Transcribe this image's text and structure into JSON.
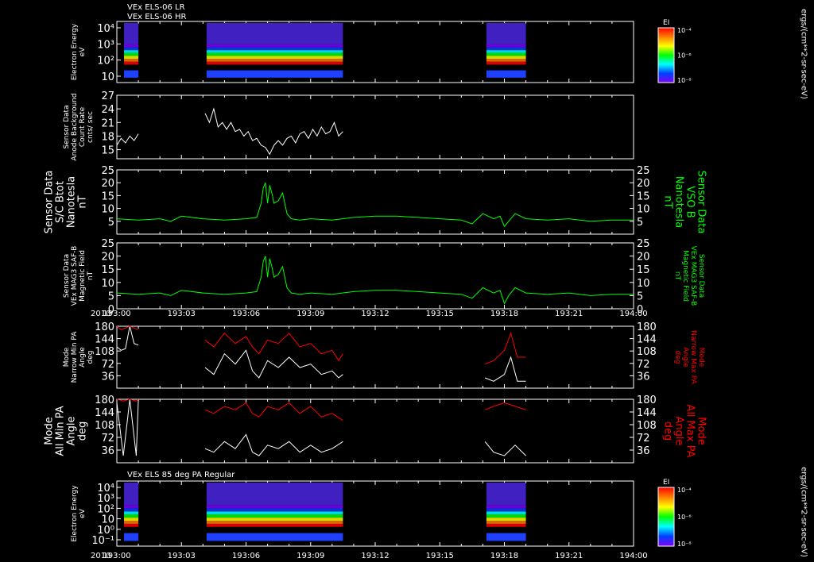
{
  "header": {
    "line1": "VEx ELS-06 LR",
    "line2": "VEx ELS-06 HR",
    "bottom_title": "VEx ELS 85 deg PA Regular"
  },
  "colorbar": {
    "label": "EI",
    "ticks": [
      "10⁻⁴",
      "10⁻⁶",
      "10⁻⁸"
    ],
    "unit": "ergs/(cm**2-sr-sec-eV)",
    "colors": [
      "#ff0000",
      "#ff8000",
      "#ffff00",
      "#00ff00",
      "#00ffff",
      "#0040ff",
      "#8000ff"
    ]
  },
  "x_axis": {
    "year": "2010",
    "ticks": [
      "193:00",
      "193:03",
      "193:06",
      "193:09",
      "193:12",
      "193:15",
      "193:18",
      "193:21",
      "194:00"
    ]
  },
  "colors": {
    "white": "#ffffff",
    "green": "#00ff00",
    "red": "#ff0000"
  },
  "chart_data": [
    {
      "type": "heatmap",
      "name": "panel1",
      "ylabel": [
        "Electron Energy",
        "eV"
      ],
      "yticks": [
        "10⁴",
        "10³",
        "10²",
        "10"
      ],
      "active_intervals": [
        [
          "193:00:20",
          "193:01:00"
        ],
        [
          "193:04:10",
          "193:10:30"
        ],
        [
          "193:17:10",
          "193:19:00"
        ]
      ]
    },
    {
      "type": "line",
      "name": "panel2",
      "ylabel": [
        "Sensor Data",
        "Anode Background",
        "Count Rate",
        "cnts/ sec"
      ],
      "yticks": [
        "27",
        "24",
        "21",
        "18",
        "15"
      ],
      "ylim": [
        13,
        27
      ],
      "series": [
        {
          "color": "white",
          "x": [
            0.0,
            0.2,
            0.4,
            0.6,
            0.8,
            1.0
          ],
          "y": [
            16,
            17.5,
            16.5,
            18,
            17,
            18.5
          ]
        },
        {
          "color": "white",
          "x": [
            4.1,
            4.3,
            4.5,
            4.7,
            4.9,
            5.1,
            5.3,
            5.5,
            5.7,
            5.9,
            6.1,
            6.3,
            6.5,
            6.7,
            6.9,
            7.1,
            7.3,
            7.5,
            7.7,
            7.9,
            8.1,
            8.3,
            8.5,
            8.7,
            8.9,
            9.1,
            9.3,
            9.5,
            9.7,
            9.9,
            10.1,
            10.3,
            10.5
          ],
          "y": [
            23,
            21,
            24,
            20,
            21,
            19.5,
            21,
            19,
            19.5,
            18,
            19,
            17,
            17.5,
            16,
            15.5,
            14,
            16,
            17,
            16,
            17.5,
            18,
            16.5,
            18.5,
            19,
            17.5,
            19.5,
            18,
            20,
            18.5,
            19,
            21,
            18,
            19
          ]
        }
      ]
    },
    {
      "type": "line",
      "name": "panel3",
      "ylabel": [
        "Sensor Data",
        "S/C Btot",
        "Nanotesla",
        "nT"
      ],
      "ylabel_right": [
        "Sensor Data",
        "VSO B",
        "Nanotesla",
        "nT"
      ],
      "yticks": [
        "25",
        "20",
        "15",
        "10",
        "5"
      ],
      "ylim": [
        0,
        25
      ],
      "series": [
        {
          "color": "green",
          "x": [
            0,
            1,
            2,
            2.5,
            3,
            4,
            5,
            6,
            6.5,
            6.7,
            6.8,
            6.9,
            7.0,
            7.1,
            7.2,
            7.3,
            7.5,
            7.7,
            7.9,
            8.1,
            8.5,
            9,
            10,
            11,
            12,
            13,
            14,
            15,
            16,
            16.5,
            17,
            17.5,
            17.8,
            18,
            18.2,
            18.5,
            19,
            20,
            21,
            22,
            23,
            24
          ],
          "y": [
            6,
            5.5,
            6,
            5,
            7,
            6,
            5.5,
            6,
            6.5,
            12,
            18,
            20,
            12,
            19,
            16,
            12,
            13,
            16,
            8,
            6,
            5.5,
            6,
            5.5,
            6.5,
            7,
            7,
            6.5,
            6,
            5.5,
            4,
            8,
            6,
            7,
            3,
            5,
            8,
            6,
            5.5,
            6,
            5,
            5.5,
            5.5
          ]
        }
      ]
    },
    {
      "type": "line",
      "name": "panel4",
      "ylabel": [
        "Sensor Data",
        "VEx MAG3 SAF-B",
        "Magnetic Field",
        "nT"
      ],
      "ylabel_right": [
        "Sensor Data",
        "VEx MAG3 SAF-B",
        "Magnetic Field",
        "nT"
      ],
      "yticks": [
        "25",
        "20",
        "15",
        "10",
        "5",
        "0"
      ],
      "ylim": [
        0,
        25
      ],
      "series": [
        {
          "color": "green",
          "x": [
            0,
            1,
            2,
            2.5,
            3,
            4,
            5,
            6,
            6.5,
            6.7,
            6.8,
            6.9,
            7.0,
            7.1,
            7.2,
            7.3,
            7.5,
            7.7,
            7.9,
            8.1,
            8.5,
            9,
            10,
            11,
            12,
            13,
            14,
            15,
            16,
            16.5,
            17,
            17.5,
            17.8,
            18,
            18.2,
            18.5,
            19,
            20,
            21,
            22,
            23,
            24
          ],
          "y": [
            6,
            5.5,
            6,
            5,
            7,
            6,
            5.5,
            6,
            6.5,
            12,
            18,
            20,
            12,
            19,
            16,
            12,
            13,
            16,
            8,
            6,
            5.5,
            6,
            5.5,
            6.5,
            7,
            7,
            6.5,
            6,
            5.5,
            4,
            8,
            6,
            7,
            2,
            5,
            8,
            6,
            5.5,
            6,
            5,
            5.5,
            5.5
          ]
        }
      ]
    },
    {
      "type": "line",
      "name": "panel5",
      "ylabel": [
        "Mode",
        "Narrow Min PA",
        "Angle",
        "deg"
      ],
      "ylabel_right": [
        "Mode",
        "Narrow Max PA",
        "Angle",
        "deg"
      ],
      "yticks": [
        "180",
        "144",
        "108",
        "72",
        "36"
      ],
      "ylim": [
        0,
        180
      ],
      "series": [
        {
          "color": "white",
          "x": [
            0,
            0.2,
            0.4,
            0.6,
            0.8,
            1.0
          ],
          "y": [
            120,
            110,
            115,
            180,
            130,
            125
          ]
        },
        {
          "color": "red",
          "x": [
            0,
            0.2,
            0.4,
            0.6,
            0.8,
            1.0
          ],
          "y": [
            180,
            170,
            175,
            180,
            175,
            170
          ]
        },
        {
          "color": "white",
          "x": [
            4.1,
            4.5,
            5.0,
            5.5,
            6.0,
            6.3,
            6.6,
            7.0,
            7.5,
            8.0,
            8.5,
            9.0,
            9.5,
            10.0,
            10.3,
            10.5
          ],
          "y": [
            60,
            40,
            100,
            70,
            110,
            50,
            30,
            80,
            60,
            90,
            60,
            70,
            40,
            50,
            30,
            40
          ]
        },
        {
          "color": "red",
          "x": [
            4.1,
            4.5,
            5.0,
            5.5,
            6.0,
            6.3,
            6.6,
            7.0,
            7.5,
            8.0,
            8.5,
            9.0,
            9.5,
            10.0,
            10.3,
            10.5
          ],
          "y": [
            140,
            120,
            160,
            130,
            150,
            120,
            100,
            140,
            130,
            160,
            120,
            130,
            100,
            110,
            80,
            100
          ]
        },
        {
          "color": "white",
          "x": [
            17.1,
            17.5,
            18.0,
            18.3,
            18.6,
            19.0
          ],
          "y": [
            30,
            20,
            40,
            90,
            20,
            20
          ]
        },
        {
          "color": "red",
          "x": [
            17.1,
            17.5,
            18.0,
            18.3,
            18.6,
            19.0
          ],
          "y": [
            70,
            80,
            110,
            160,
            90,
            90
          ]
        }
      ]
    },
    {
      "type": "line",
      "name": "panel6",
      "ylabel": [
        "Mode",
        "All Min PA",
        "Angle",
        "deg"
      ],
      "ylabel_right": [
        "Mode",
        "All Max PA",
        "Angle",
        "deg"
      ],
      "yticks": [
        "180",
        "144",
        "108",
        "72",
        "36"
      ],
      "ylim": [
        0,
        180
      ],
      "series": [
        {
          "color": "white",
          "x": [
            0,
            0.3,
            0.6,
            0.9,
            1.0
          ],
          "y": [
            170,
            20,
            180,
            20,
            180
          ]
        },
        {
          "color": "red",
          "x": [
            0,
            0.3,
            0.6,
            0.9,
            1.0
          ],
          "y": [
            180,
            175,
            180,
            175,
            180
          ]
        },
        {
          "color": "white",
          "x": [
            4.1,
            4.5,
            5.0,
            5.5,
            6.0,
            6.3,
            6.6,
            7.0,
            7.5,
            8.0,
            8.5,
            9.0,
            9.5,
            10.0,
            10.5
          ],
          "y": [
            40,
            30,
            60,
            40,
            80,
            30,
            20,
            50,
            40,
            60,
            30,
            50,
            30,
            40,
            60
          ]
        },
        {
          "color": "red",
          "x": [
            4.1,
            4.5,
            5.0,
            5.5,
            6.0,
            6.3,
            6.6,
            7.0,
            7.5,
            8.0,
            8.5,
            9.0,
            9.5,
            10.0,
            10.5
          ],
          "y": [
            150,
            140,
            160,
            150,
            170,
            140,
            130,
            160,
            150,
            170,
            140,
            160,
            130,
            140,
            120
          ]
        },
        {
          "color": "white",
          "x": [
            17.1,
            17.5,
            18.0,
            18.5,
            19.0
          ],
          "y": [
            60,
            30,
            20,
            50,
            20
          ]
        },
        {
          "color": "red",
          "x": [
            17.1,
            17.5,
            18.0,
            18.5,
            19.0
          ],
          "y": [
            150,
            160,
            170,
            160,
            150
          ]
        }
      ]
    },
    {
      "type": "heatmap",
      "name": "panel7",
      "ylabel": [
        "Electron Energy",
        "eV"
      ],
      "yticks": [
        "10⁴",
        "10³",
        "10²",
        "10",
        "10⁰",
        "10⁻¹"
      ],
      "active_intervals": [
        [
          "193:00:20",
          "193:01:00"
        ],
        [
          "193:04:10",
          "193:10:30"
        ],
        [
          "193:17:10",
          "193:19:00"
        ]
      ]
    }
  ]
}
